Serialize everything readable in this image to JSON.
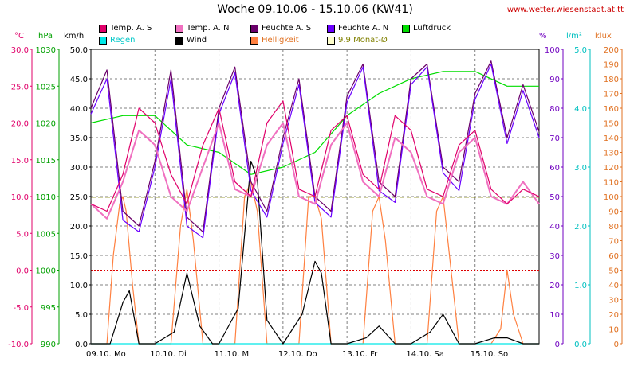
{
  "title": "Woche 09.10.06 - 15.10.06 (KW41)",
  "source_url": "www.wetter.wiesenstadt.at.tt",
  "legend": [
    {
      "label": "Temp. A. S",
      "color": "#e0006a"
    },
    {
      "label": "Temp. A. N",
      "color": "#f070c0"
    },
    {
      "label": "Feuchte A. S",
      "color": "#6a006a"
    },
    {
      "label": "Feuchte A. N",
      "color": "#6a00ff"
    },
    {
      "label": "Luftdruck",
      "color": "#00dd00"
    },
    {
      "label": "Regen",
      "color": "#00e8e8"
    },
    {
      "label": "Wind",
      "color": "#000000"
    },
    {
      "label": "Helligkeit",
      "color": "#ff8040"
    },
    {
      "label": "9.9 Monat-Ø",
      "color": "#ffffcc"
    }
  ],
  "units": {
    "temp": "°C",
    "pressure": "hPa",
    "wind": "km/h",
    "humidity": "%",
    "rain": "l/m²",
    "light": "klux"
  },
  "chart_data": {
    "type": "line",
    "title": "Woche 09.10.06 - 15.10.06 (KW41)",
    "x_labels": [
      "09.10. Mo",
      "10.10. Di",
      "11.10. Mi",
      "12.10. Do",
      "13.10. Fr",
      "14.10. Sa",
      "15.10. So"
    ],
    "axes": {
      "temp": {
        "label": "°C",
        "range": [
          -10,
          30
        ],
        "ticks": [
          "30.0",
          "25.0",
          "20.0",
          "15.0",
          "10.0",
          "5.0",
          "0.0",
          "-5.0",
          "-10.0"
        ],
        "color": "#e0006a"
      },
      "pressure": {
        "label": "hPa",
        "range": [
          990,
          1030
        ],
        "ticks": [
          "1030",
          "1025",
          "1020",
          "1015",
          "1010",
          "1005",
          "1000",
          "995",
          "990"
        ],
        "color": "#00a000"
      },
      "wind": {
        "label": "km/h",
        "range": [
          0,
          50
        ],
        "ticks": [
          "50.0",
          "45.0",
          "40.0",
          "35.0",
          "30.0",
          "25.0",
          "20.0",
          "15.0",
          "10.0",
          "5.0",
          "0.0"
        ],
        "color": "#000000"
      },
      "humidity": {
        "label": "%",
        "range": [
          0,
          100
        ],
        "ticks": [
          "100",
          "90",
          "80",
          "70",
          "60",
          "50",
          "40",
          "30",
          "20",
          "10",
          "0"
        ],
        "color": "#7000c0"
      },
      "rain": {
        "label": "l/m²",
        "range": [
          0,
          5
        ],
        "ticks": [
          "5.0",
          "4.0",
          "3.0",
          "2.0",
          "1.0",
          "0.0"
        ],
        "color": "#00c0c0"
      },
      "light": {
        "label": "klux",
        "range": [
          0,
          200
        ],
        "ticks": [
          "200",
          "190",
          "180",
          "170",
          "160",
          "150",
          "140",
          "130",
          "120",
          "110",
          "100",
          "90",
          "80",
          "70",
          "60",
          "50",
          "40",
          "30",
          "20",
          "10",
          "0"
        ],
        "color": "#e07020"
      }
    },
    "grid": true,
    "reference_lines": [
      {
        "name": "Monat-Ø",
        "axis": "temp",
        "value": 9.9
      },
      {
        "name": "0 °C",
        "axis": "temp",
        "value": 0
      }
    ],
    "series": [
      {
        "name": "Temp. A. S",
        "axis": "temp",
        "color": "#e0006a",
        "x": [
          0,
          0.25,
          0.5,
          0.75,
          1,
          1.25,
          1.5,
          1.75,
          2,
          2.25,
          2.5,
          2.75,
          3,
          3.25,
          3.5,
          3.75,
          4,
          4.25,
          4.5,
          4.75,
          5,
          5.25,
          5.5,
          5.75,
          6,
          6.25,
          6.5,
          6.75,
          7
        ],
        "y": [
          9,
          8,
          13,
          22,
          20,
          13,
          9,
          17,
          22,
          12,
          10,
          20,
          23,
          11,
          10,
          19,
          21,
          13,
          11,
          21,
          19,
          11,
          10,
          17,
          19,
          11,
          9,
          11,
          10
        ]
      },
      {
        "name": "Temp. A. N",
        "axis": "temp",
        "color": "#f070c0",
        "x": [
          0,
          0.25,
          0.5,
          0.75,
          1,
          1.25,
          1.5,
          1.75,
          2,
          2.25,
          2.5,
          2.75,
          3,
          3.25,
          3.5,
          3.75,
          4,
          4.25,
          4.5,
          4.75,
          5,
          5.25,
          5.5,
          5.75,
          6,
          6.25,
          6.5,
          6.75,
          7
        ],
        "y": [
          9,
          7,
          12,
          19,
          17,
          10,
          8,
          14,
          20,
          11,
          10,
          17,
          20,
          10,
          9,
          17,
          20,
          12,
          10,
          18,
          16,
          10,
          9,
          16,
          18,
          10,
          9,
          12,
          9
        ]
      },
      {
        "name": "Feuchte A. S",
        "axis": "humidity",
        "color": "#6a006a",
        "x": [
          0,
          0.25,
          0.5,
          0.75,
          1,
          1.25,
          1.5,
          1.75,
          2,
          2.25,
          2.5,
          2.75,
          3,
          3.25,
          3.5,
          3.75,
          4,
          4.25,
          4.5,
          4.75,
          5,
          5.25,
          5.5,
          5.75,
          6,
          6.25,
          6.5,
          6.75,
          7
        ],
        "y": [
          80,
          93,
          45,
          40,
          62,
          93,
          43,
          38,
          80,
          94,
          55,
          45,
          70,
          90,
          50,
          45,
          84,
          95,
          55,
          50,
          90,
          95,
          60,
          55,
          85,
          96,
          70,
          88,
          72
        ]
      },
      {
        "name": "Feuchte A. N",
        "axis": "humidity",
        "color": "#6a00ff",
        "x": [
          0,
          0.25,
          0.5,
          0.75,
          1,
          1.25,
          1.5,
          1.75,
          2,
          2.25,
          2.5,
          2.75,
          3,
          3.25,
          3.5,
          3.75,
          4,
          4.25,
          4.5,
          4.75,
          5,
          5.25,
          5.5,
          5.75,
          6,
          6.25,
          6.5,
          6.75,
          7
        ],
        "y": [
          78,
          90,
          42,
          38,
          60,
          90,
          40,
          36,
          78,
          92,
          52,
          43,
          68,
          88,
          48,
          43,
          82,
          94,
          52,
          48,
          88,
          94,
          58,
          52,
          83,
          95,
          68,
          86,
          70
        ]
      },
      {
        "name": "Luftdruck",
        "axis": "pressure",
        "color": "#00dd00",
        "x": [
          0,
          0.5,
          1,
          1.5,
          2,
          2.5,
          3,
          3.5,
          4,
          4.5,
          5,
          5.5,
          6,
          6.5,
          7
        ],
        "y": [
          1020,
          1021,
          1021,
          1017,
          1016,
          1013,
          1014,
          1016,
          1021,
          1024,
          1026,
          1027,
          1027,
          1025,
          1025
        ]
      },
      {
        "name": "Wind",
        "axis": "wind",
        "color": "#000000",
        "x": [
          0,
          0.3,
          0.5,
          0.6,
          0.75,
          1,
          1.3,
          1.5,
          1.7,
          1.9,
          2,
          2.3,
          2.5,
          2.6,
          2.75,
          3,
          3.3,
          3.5,
          3.6,
          3.75,
          4,
          4.3,
          4.5,
          4.75,
          5,
          5.3,
          5.5,
          5.75,
          6,
          6.3,
          6.5,
          6.75,
          7
        ],
        "y": [
          0,
          0,
          7,
          9,
          0,
          0,
          2,
          12,
          3,
          0,
          0,
          6,
          31,
          28,
          4,
          0,
          5,
          14,
          12,
          0,
          0,
          1,
          3,
          0,
          0,
          2,
          5,
          0,
          0,
          1,
          1,
          0,
          0
        ]
      },
      {
        "name": "Helligkeit",
        "axis": "light",
        "color": "#ff8040",
        "x": [
          0,
          0.25,
          0.35,
          0.45,
          0.5,
          0.55,
          0.65,
          0.75,
          1,
          1.25,
          1.4,
          1.5,
          1.6,
          1.75,
          2,
          2.25,
          2.4,
          2.5,
          2.6,
          2.75,
          3,
          3.25,
          3.4,
          3.5,
          3.6,
          3.75,
          4,
          4.25,
          4.4,
          4.5,
          4.6,
          4.75,
          5,
          5.25,
          5.4,
          5.5,
          5.6,
          5.75,
          6,
          6.25,
          6.4,
          6.5,
          6.6,
          6.75,
          7
        ],
        "y": [
          0,
          0,
          60,
          95,
          100,
          90,
          40,
          0,
          0,
          0,
          80,
          105,
          70,
          0,
          0,
          0,
          100,
          110,
          90,
          0,
          0,
          0,
          100,
          100,
          85,
          0,
          0,
          0,
          90,
          100,
          70,
          0,
          0,
          0,
          90,
          100,
          60,
          0,
          0,
          0,
          10,
          50,
          20,
          0,
          0
        ]
      },
      {
        "name": "Regen",
        "axis": "rain",
        "color": "#00e8e8",
        "x": [
          0,
          7
        ],
        "y": [
          0,
          0
        ]
      }
    ]
  }
}
